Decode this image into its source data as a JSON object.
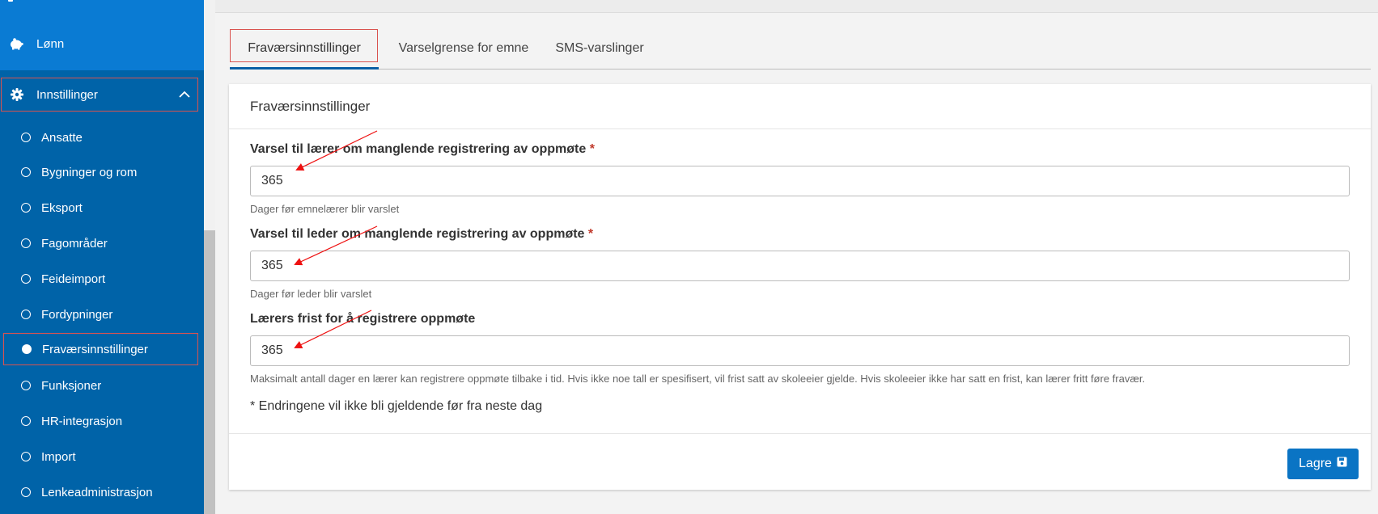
{
  "sidebar": {
    "top_item": {
      "label": "Lønn",
      "icon": "piggy-bank-icon"
    },
    "section": {
      "label": "Innstillinger",
      "icon": "gear-icon",
      "expanded": true
    },
    "sub_items": [
      {
        "label": "Ansatte"
      },
      {
        "label": "Bygninger og rom"
      },
      {
        "label": "Eksport"
      },
      {
        "label": "Fagområder"
      },
      {
        "label": "Feideimport"
      },
      {
        "label": "Fordypninger"
      },
      {
        "label": "Fraværsinnstillinger",
        "active": true
      },
      {
        "label": "Funksjoner"
      },
      {
        "label": "HR-integrasjon"
      },
      {
        "label": "Import"
      },
      {
        "label": "Lenkeadministrasjon"
      }
    ]
  },
  "tabs": [
    {
      "label": "Fraværsinnstillinger",
      "active": true
    },
    {
      "label": "Varselgrense for emne"
    },
    {
      "label": "SMS-varslinger"
    }
  ],
  "card": {
    "title": "Fraværsinnstillinger",
    "fields": [
      {
        "label": "Varsel til lærer om manglende registrering av oppmøte",
        "required_mark": "*",
        "value": "365",
        "help": "Dager før emnelærer blir varslet"
      },
      {
        "label": "Varsel til leder om manglende registrering av oppmøte",
        "required_mark": "*",
        "value": "365",
        "help": "Dager før leder blir varslet"
      },
      {
        "label": "Lærers frist for å registrere oppmøte",
        "required_mark": "",
        "value": "365",
        "help": "Maksimalt antall dager en lærer kan registrere oppmøte tilbake i tid. Hvis ikke noe tall er spesifisert, vil frist satt av skoleeier gjelde. Hvis skoleeier ikke har satt en frist, kan lærer fritt føre fravær."
      }
    ],
    "note": "* Endringene vil ikke bli gjeldende før fra neste dag",
    "save_label": "Lagre",
    "save_icon": "floppy-disk-icon"
  },
  "colors": {
    "sidebar_bg": "#0063a8",
    "sidebar_top_bg": "#0a7bd3",
    "highlight_border": "#d9534f",
    "primary_button": "#0a74c4",
    "annotation_arrow": "#ee1111"
  }
}
